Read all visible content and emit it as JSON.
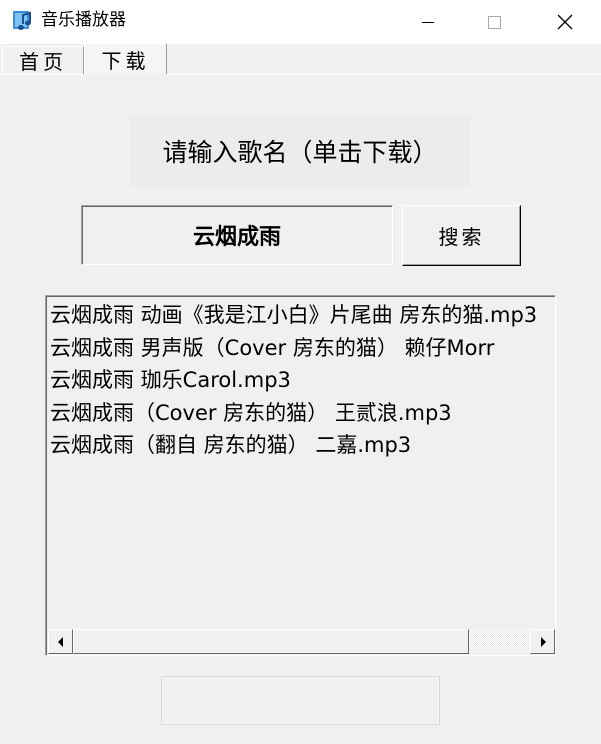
{
  "window": {
    "title": "音乐播放器"
  },
  "tabs": [
    {
      "label": "首页"
    },
    {
      "label": "下载",
      "selected": true
    }
  ],
  "main": {
    "prompt": "请输入歌名（单击下载）",
    "song_input_value": "云烟成雨",
    "search_button": "搜索",
    "results": [
      "云烟成雨 动画《我是江小白》片尾曲 房东的猫.mp3",
      "云烟成雨 男声版（Cover 房东的猫） 赖仔Morr",
      "云烟成雨 珈乐Carol.mp3",
      "云烟成雨（Cover 房东的猫） 王贰浪.mp3",
      "云烟成雨（翻自 房东的猫）  二嘉.mp3"
    ],
    "status_text": ""
  },
  "colors": {
    "window_bg": "#f0f0f0",
    "titlebar_bg": "#ffffff"
  }
}
